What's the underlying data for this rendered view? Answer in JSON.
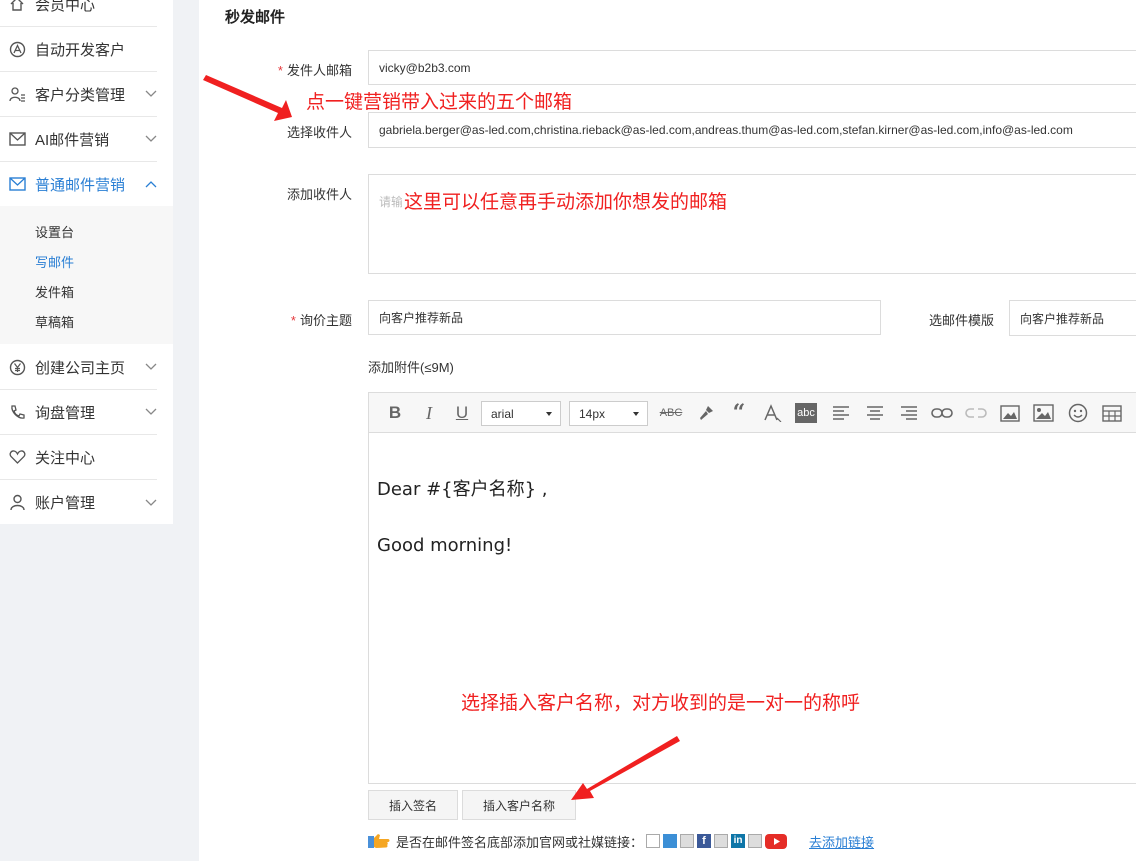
{
  "sidebar": {
    "items": [
      {
        "label": "会员中心",
        "icon": "home-icon"
      },
      {
        "label": "自动开发客户",
        "icon": "auto-icon"
      },
      {
        "label": "客户分类管理",
        "icon": "users-icon"
      },
      {
        "label": "AI邮件营销",
        "icon": "mail-icon"
      },
      {
        "label": "普通邮件营销",
        "icon": "mail-icon"
      },
      {
        "label": "创建公司主页",
        "icon": "yen-icon"
      },
      {
        "label": "询盘管理",
        "icon": "phone-icon"
      },
      {
        "label": "关注中心",
        "icon": "heart-icon"
      },
      {
        "label": "账户管理",
        "icon": "user-icon"
      }
    ],
    "subitems": [
      "设置台",
      "写邮件",
      "发件箱",
      "草稿箱"
    ],
    "active_color": "#2a7fd4"
  },
  "form": {
    "title": "秒发邮件",
    "sender_label": "发件人邮箱",
    "sender_value": "vicky@b2b3.com",
    "recipient_label": "选择收件人",
    "recipient_value": "gabriela.berger@as-led.com,christina.rieback@as-led.com,andreas.thum@as-led.com,stefan.kirner@as-led.com,info@as-led.com",
    "add_recipient_label": "添加收件人",
    "add_recipient_placeholder": "请输",
    "subject_label": "询价主题",
    "subject_value": "向客户推荐新品",
    "template_label": "选邮件模版",
    "template_value": "向客户推荐新品",
    "attachment_label": "添加附件(≤9M)"
  },
  "editor": {
    "font": "arial",
    "size": "14px",
    "line1": "Dear #{客户名称} ,",
    "line2": "Good morning!"
  },
  "buttons": {
    "insert_signature": "插入签名",
    "insert_customer_name": "插入客户名称"
  },
  "footer": {
    "question": "是否在邮件签名底部添加官网或社媒链接：",
    "add_link": "去添加链接"
  },
  "annotations": {
    "a1": "点一键营销带入过来的五个邮箱",
    "a2": "这里可以任意再手动添加你想发的邮箱",
    "a3": "选择插入客户名称，对方收到的是一对一的称呼"
  }
}
